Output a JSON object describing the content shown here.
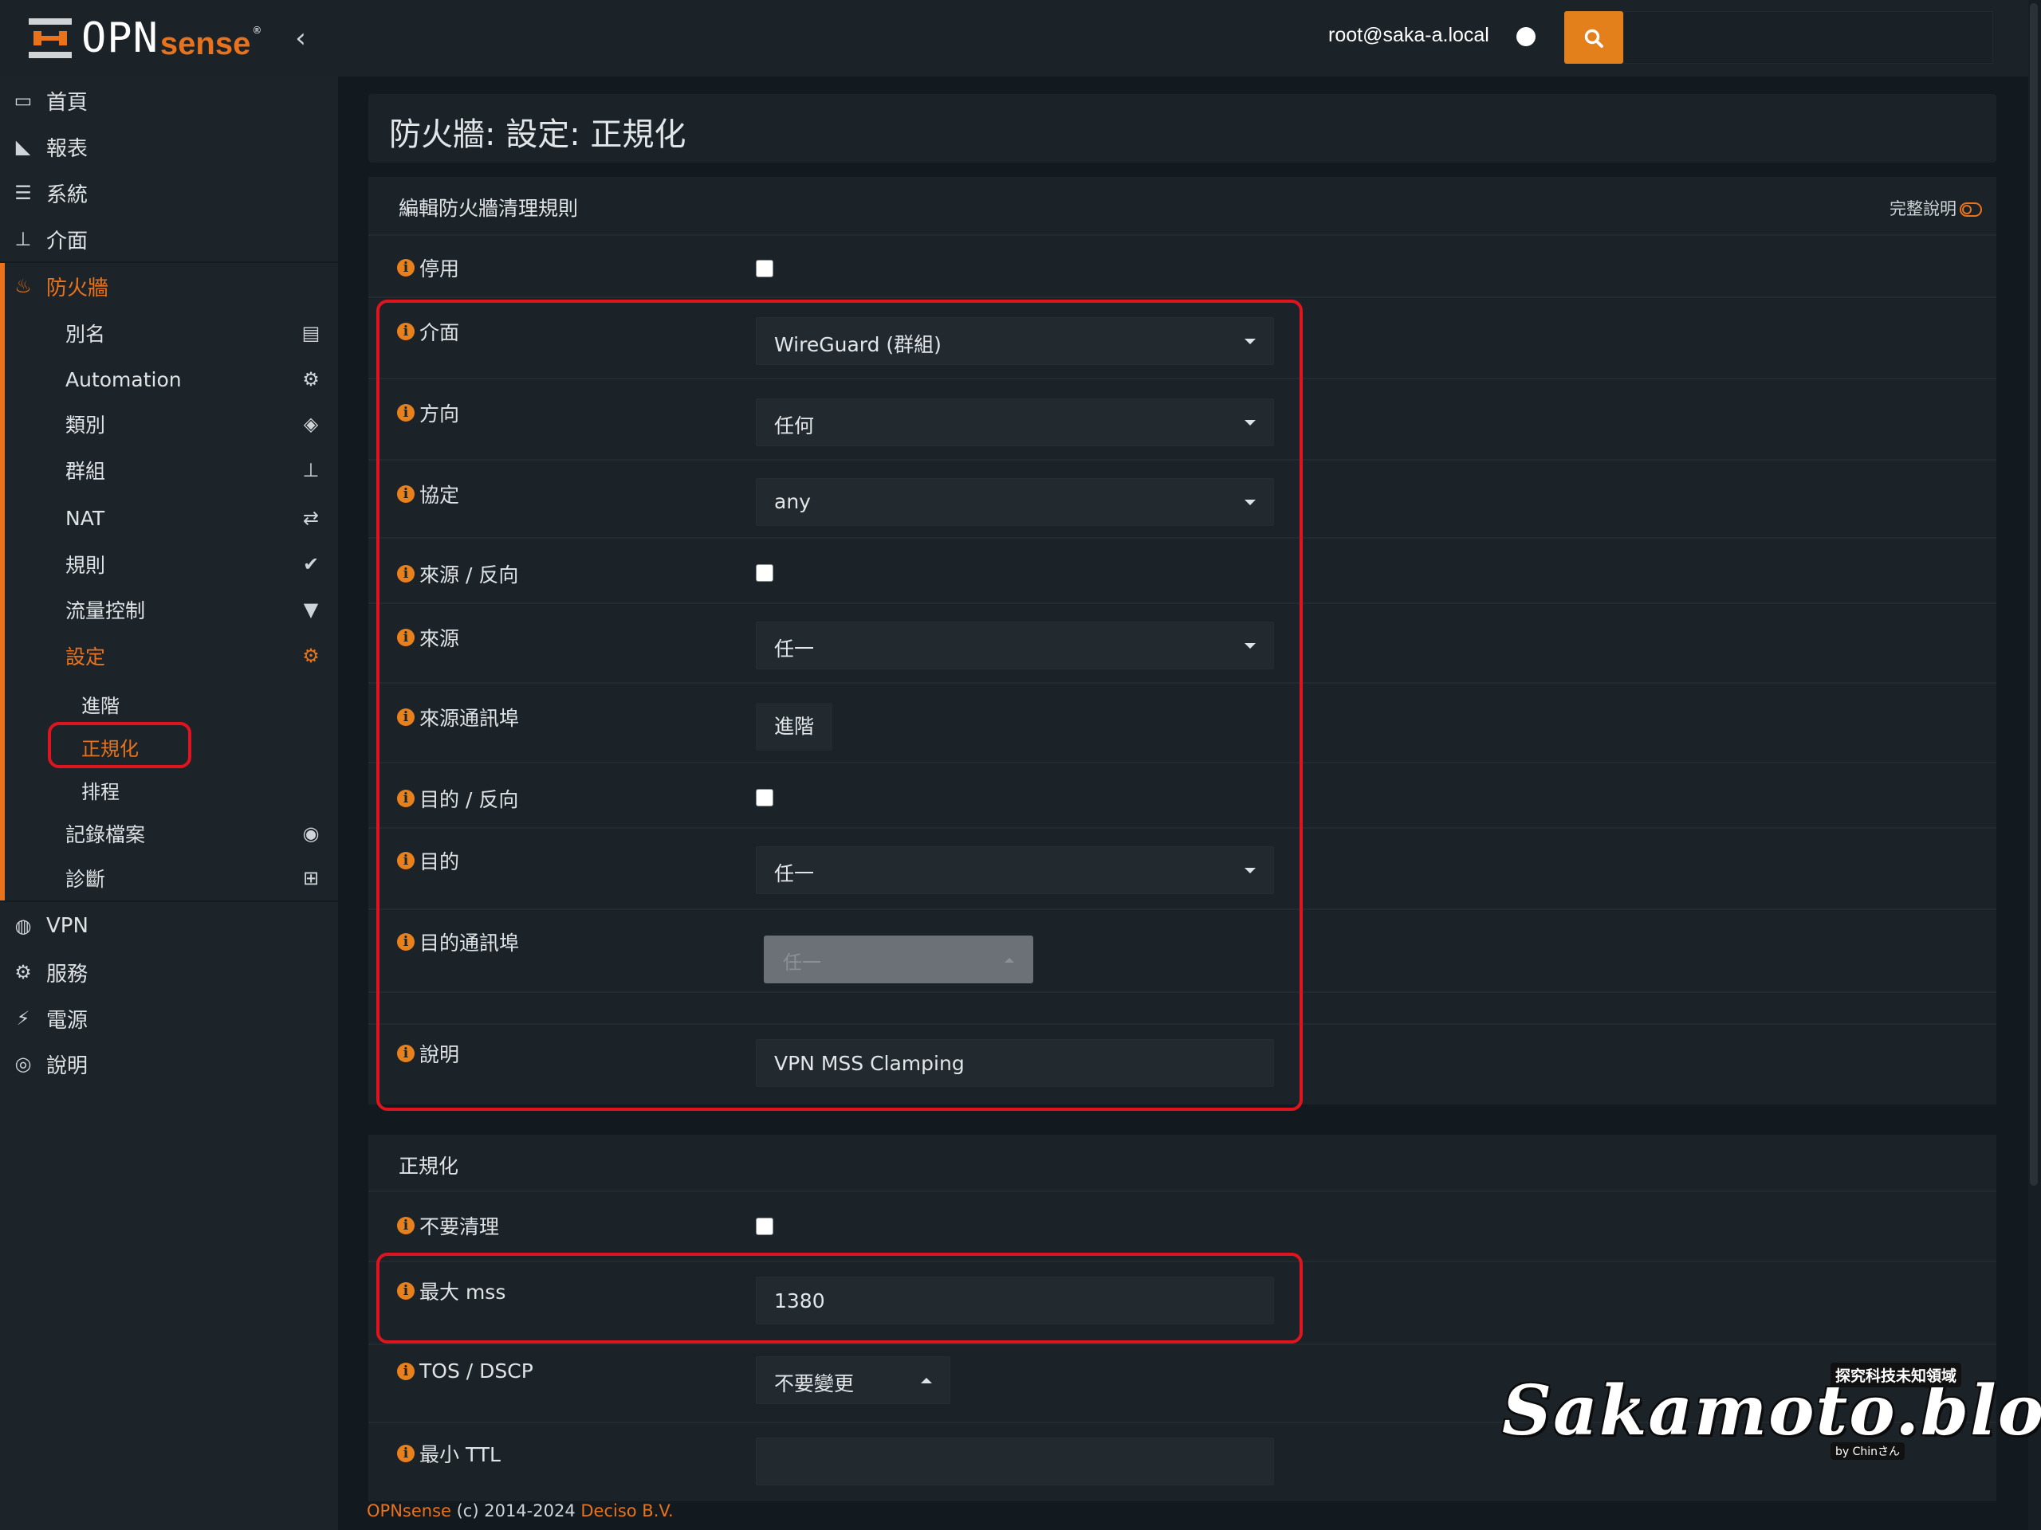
{
  "header": {
    "logo_open": "OPN",
    "logo_sense": "sense",
    "logo_reg": "®",
    "user": "root@saka-a.local",
    "collapse_icon": "chevron-left-icon",
    "search_icon": "search-icon",
    "accent_color": "#e8731c"
  },
  "sidebar": {
    "items": [
      {
        "label": "首頁",
        "icon": "laptop-icon"
      },
      {
        "label": "報表",
        "icon": "area-chart-icon"
      },
      {
        "label": "系統",
        "icon": "server-icon"
      },
      {
        "label": "介面",
        "icon": "sitemap-icon"
      },
      {
        "label": "防火牆",
        "icon": "fire-icon",
        "active": true
      },
      {
        "label": "VPN",
        "icon": "globe-icon"
      },
      {
        "label": "服務",
        "icon": "gear-icon"
      },
      {
        "label": "電源",
        "icon": "plug-icon"
      },
      {
        "label": "說明",
        "icon": "life-ring-icon"
      }
    ],
    "firewall_sub": [
      {
        "label": "別名",
        "icon": "list-alt-icon"
      },
      {
        "label": "Automation",
        "icon": "cog-icon"
      },
      {
        "label": "類別",
        "icon": "tags-icon"
      },
      {
        "label": "群組",
        "icon": "sitemap-icon"
      },
      {
        "label": "NAT",
        "icon": "exchange-icon"
      },
      {
        "label": "規則",
        "icon": "check-icon"
      },
      {
        "label": "流量控制",
        "icon": "filter-icon"
      },
      {
        "label": "設定",
        "icon": "cogs-icon",
        "active": true
      },
      {
        "label": "記錄檔案",
        "icon": "eye-icon"
      },
      {
        "label": "診斷",
        "icon": "medkit-icon"
      }
    ],
    "settings_sub": [
      {
        "label": "進階"
      },
      {
        "label": "正規化",
        "active": true
      },
      {
        "label": "排程"
      }
    ]
  },
  "page": {
    "title": "防火牆: 設定: 正規化"
  },
  "rule_panel": {
    "title": "編輯防火牆清理規則",
    "help_toggle": "完整說明",
    "fields": {
      "disabled": {
        "label": "停用"
      },
      "interface": {
        "label": "介面",
        "value": "WireGuard (群組)"
      },
      "direction": {
        "label": "方向",
        "value": "任何"
      },
      "protocol": {
        "label": "協定",
        "value": "any"
      },
      "source_invert": {
        "label": "來源 / 反向"
      },
      "source": {
        "label": "來源",
        "value": "任一"
      },
      "source_port": {
        "label": "來源通訊埠",
        "button": "進階"
      },
      "dest_invert": {
        "label": "目的 / 反向"
      },
      "destination": {
        "label": "目的",
        "value": "任一"
      },
      "dest_port": {
        "label": "目的通訊埠",
        "value": "任一"
      },
      "description": {
        "label": "說明",
        "value": "VPN MSS Clamping"
      }
    }
  },
  "norm_panel": {
    "title": "正規化",
    "fields": {
      "no_scrub": {
        "label": "不要清理"
      },
      "max_mss": {
        "label": "最大 mss",
        "value": "1380"
      },
      "tos": {
        "label": "TOS / DSCP",
        "value": "不要變更"
      },
      "min_ttl": {
        "label": "最小 TTL",
        "value": ""
      }
    }
  },
  "footer": {
    "brand": "OPNsense",
    "copy": " (c) 2014-2024 ",
    "company": "Deciso B.V."
  },
  "watermark": {
    "main": "Sakamoto.blog",
    "tag": "探究科技未知領域",
    "by": "by Chinさん"
  }
}
